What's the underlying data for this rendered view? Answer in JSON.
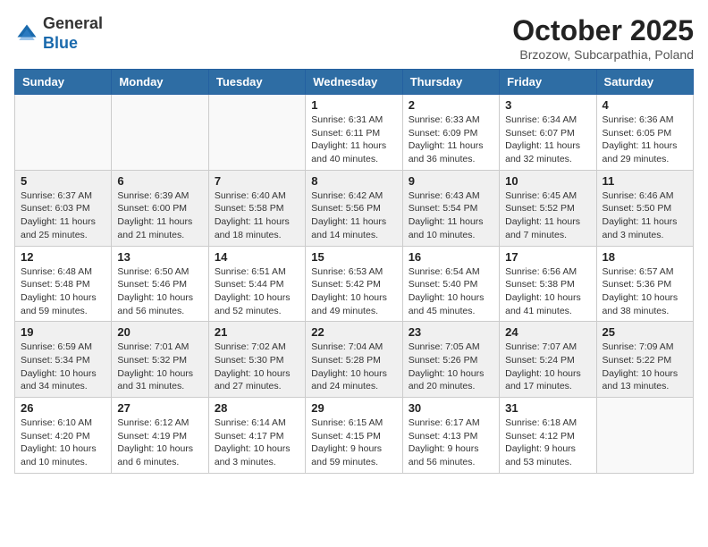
{
  "header": {
    "logo_line1": "General",
    "logo_line2": "Blue",
    "month_title": "October 2025",
    "location": "Brzozow, Subcarpathia, Poland"
  },
  "days_of_week": [
    "Sunday",
    "Monday",
    "Tuesday",
    "Wednesday",
    "Thursday",
    "Friday",
    "Saturday"
  ],
  "weeks": [
    {
      "shaded": false,
      "days": [
        {
          "num": "",
          "info": ""
        },
        {
          "num": "",
          "info": ""
        },
        {
          "num": "",
          "info": ""
        },
        {
          "num": "1",
          "info": "Sunrise: 6:31 AM\nSunset: 6:11 PM\nDaylight: 11 hours\nand 40 minutes."
        },
        {
          "num": "2",
          "info": "Sunrise: 6:33 AM\nSunset: 6:09 PM\nDaylight: 11 hours\nand 36 minutes."
        },
        {
          "num": "3",
          "info": "Sunrise: 6:34 AM\nSunset: 6:07 PM\nDaylight: 11 hours\nand 32 minutes."
        },
        {
          "num": "4",
          "info": "Sunrise: 6:36 AM\nSunset: 6:05 PM\nDaylight: 11 hours\nand 29 minutes."
        }
      ]
    },
    {
      "shaded": true,
      "days": [
        {
          "num": "5",
          "info": "Sunrise: 6:37 AM\nSunset: 6:03 PM\nDaylight: 11 hours\nand 25 minutes."
        },
        {
          "num": "6",
          "info": "Sunrise: 6:39 AM\nSunset: 6:00 PM\nDaylight: 11 hours\nand 21 minutes."
        },
        {
          "num": "7",
          "info": "Sunrise: 6:40 AM\nSunset: 5:58 PM\nDaylight: 11 hours\nand 18 minutes."
        },
        {
          "num": "8",
          "info": "Sunrise: 6:42 AM\nSunset: 5:56 PM\nDaylight: 11 hours\nand 14 minutes."
        },
        {
          "num": "9",
          "info": "Sunrise: 6:43 AM\nSunset: 5:54 PM\nDaylight: 11 hours\nand 10 minutes."
        },
        {
          "num": "10",
          "info": "Sunrise: 6:45 AM\nSunset: 5:52 PM\nDaylight: 11 hours\nand 7 minutes."
        },
        {
          "num": "11",
          "info": "Sunrise: 6:46 AM\nSunset: 5:50 PM\nDaylight: 11 hours\nand 3 minutes."
        }
      ]
    },
    {
      "shaded": false,
      "days": [
        {
          "num": "12",
          "info": "Sunrise: 6:48 AM\nSunset: 5:48 PM\nDaylight: 10 hours\nand 59 minutes."
        },
        {
          "num": "13",
          "info": "Sunrise: 6:50 AM\nSunset: 5:46 PM\nDaylight: 10 hours\nand 56 minutes."
        },
        {
          "num": "14",
          "info": "Sunrise: 6:51 AM\nSunset: 5:44 PM\nDaylight: 10 hours\nand 52 minutes."
        },
        {
          "num": "15",
          "info": "Sunrise: 6:53 AM\nSunset: 5:42 PM\nDaylight: 10 hours\nand 49 minutes."
        },
        {
          "num": "16",
          "info": "Sunrise: 6:54 AM\nSunset: 5:40 PM\nDaylight: 10 hours\nand 45 minutes."
        },
        {
          "num": "17",
          "info": "Sunrise: 6:56 AM\nSunset: 5:38 PM\nDaylight: 10 hours\nand 41 minutes."
        },
        {
          "num": "18",
          "info": "Sunrise: 6:57 AM\nSunset: 5:36 PM\nDaylight: 10 hours\nand 38 minutes."
        }
      ]
    },
    {
      "shaded": true,
      "days": [
        {
          "num": "19",
          "info": "Sunrise: 6:59 AM\nSunset: 5:34 PM\nDaylight: 10 hours\nand 34 minutes."
        },
        {
          "num": "20",
          "info": "Sunrise: 7:01 AM\nSunset: 5:32 PM\nDaylight: 10 hours\nand 31 minutes."
        },
        {
          "num": "21",
          "info": "Sunrise: 7:02 AM\nSunset: 5:30 PM\nDaylight: 10 hours\nand 27 minutes."
        },
        {
          "num": "22",
          "info": "Sunrise: 7:04 AM\nSunset: 5:28 PM\nDaylight: 10 hours\nand 24 minutes."
        },
        {
          "num": "23",
          "info": "Sunrise: 7:05 AM\nSunset: 5:26 PM\nDaylight: 10 hours\nand 20 minutes."
        },
        {
          "num": "24",
          "info": "Sunrise: 7:07 AM\nSunset: 5:24 PM\nDaylight: 10 hours\nand 17 minutes."
        },
        {
          "num": "25",
          "info": "Sunrise: 7:09 AM\nSunset: 5:22 PM\nDaylight: 10 hours\nand 13 minutes."
        }
      ]
    },
    {
      "shaded": false,
      "days": [
        {
          "num": "26",
          "info": "Sunrise: 6:10 AM\nSunset: 4:20 PM\nDaylight: 10 hours\nand 10 minutes."
        },
        {
          "num": "27",
          "info": "Sunrise: 6:12 AM\nSunset: 4:19 PM\nDaylight: 10 hours\nand 6 minutes."
        },
        {
          "num": "28",
          "info": "Sunrise: 6:14 AM\nSunset: 4:17 PM\nDaylight: 10 hours\nand 3 minutes."
        },
        {
          "num": "29",
          "info": "Sunrise: 6:15 AM\nSunset: 4:15 PM\nDaylight: 9 hours\nand 59 minutes."
        },
        {
          "num": "30",
          "info": "Sunrise: 6:17 AM\nSunset: 4:13 PM\nDaylight: 9 hours\nand 56 minutes."
        },
        {
          "num": "31",
          "info": "Sunrise: 6:18 AM\nSunset: 4:12 PM\nDaylight: 9 hours\nand 53 minutes."
        },
        {
          "num": "",
          "info": ""
        }
      ]
    }
  ]
}
